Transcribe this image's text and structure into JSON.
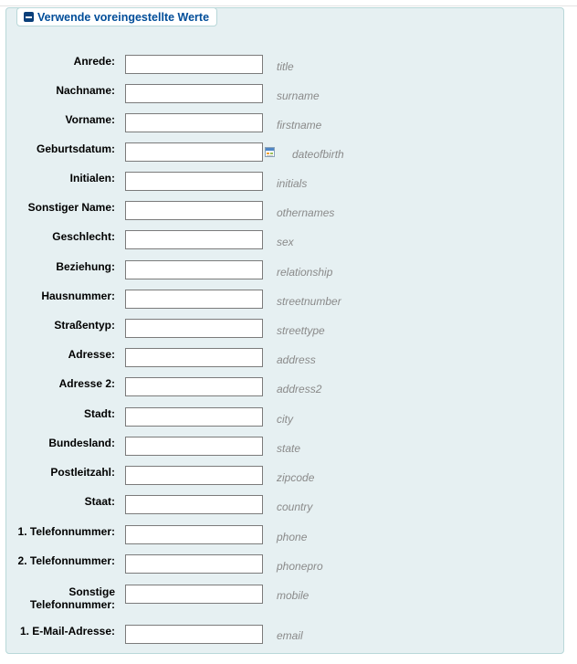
{
  "section": {
    "legend": "Verwende voreingestellte Werte",
    "toggle_icon": "minus-square-icon"
  },
  "fields": {
    "title": {
      "label": "Anrede:",
      "hint": "title",
      "value": ""
    },
    "surname": {
      "label": "Nachname:",
      "hint": "surname",
      "value": ""
    },
    "firstname": {
      "label": "Vorname:",
      "hint": "firstname",
      "value": ""
    },
    "dateofbirth": {
      "label": "Geburtsdatum:",
      "hint": "dateofbirth",
      "value": "",
      "icon": "calendar-icon"
    },
    "initials": {
      "label": "Initialen:",
      "hint": "initials",
      "value": ""
    },
    "othernames": {
      "label": "Sonstiger Name:",
      "hint": "othernames",
      "value": ""
    },
    "sex": {
      "label": "Geschlecht:",
      "hint": "sex",
      "value": ""
    },
    "relationship": {
      "label": "Beziehung:",
      "hint": "relationship",
      "value": ""
    },
    "streetnumber": {
      "label": "Hausnummer:",
      "hint": "streetnumber",
      "value": ""
    },
    "streettype": {
      "label": "Straßentyp:",
      "hint": "streettype",
      "value": ""
    },
    "address": {
      "label": "Adresse:",
      "hint": "address",
      "value": ""
    },
    "address2": {
      "label": "Adresse 2:",
      "hint": "address2",
      "value": ""
    },
    "city": {
      "label": "Stadt:",
      "hint": "city",
      "value": ""
    },
    "state": {
      "label": "Bundesland:",
      "hint": "state",
      "value": ""
    },
    "zipcode": {
      "label": "Postleitzahl:",
      "hint": "zipcode",
      "value": ""
    },
    "country": {
      "label": "Staat:",
      "hint": "country",
      "value": ""
    },
    "phone": {
      "label": "1. Telefonnummer:",
      "hint": "phone",
      "value": ""
    },
    "phonepro": {
      "label": "2. Telefonnummer:",
      "hint": "phonepro",
      "value": ""
    },
    "mobile": {
      "label": "Sonstige Telefonnummer:",
      "hint": "mobile",
      "value": ""
    },
    "email": {
      "label": "1. E-Mail-Adresse:",
      "hint": "email",
      "value": ""
    }
  },
  "colors": {
    "panel_bg": "#e6f0f2",
    "panel_border": "#b9d8d9",
    "legend_text": "#004d99",
    "hint_text": "#8a8a8a"
  }
}
